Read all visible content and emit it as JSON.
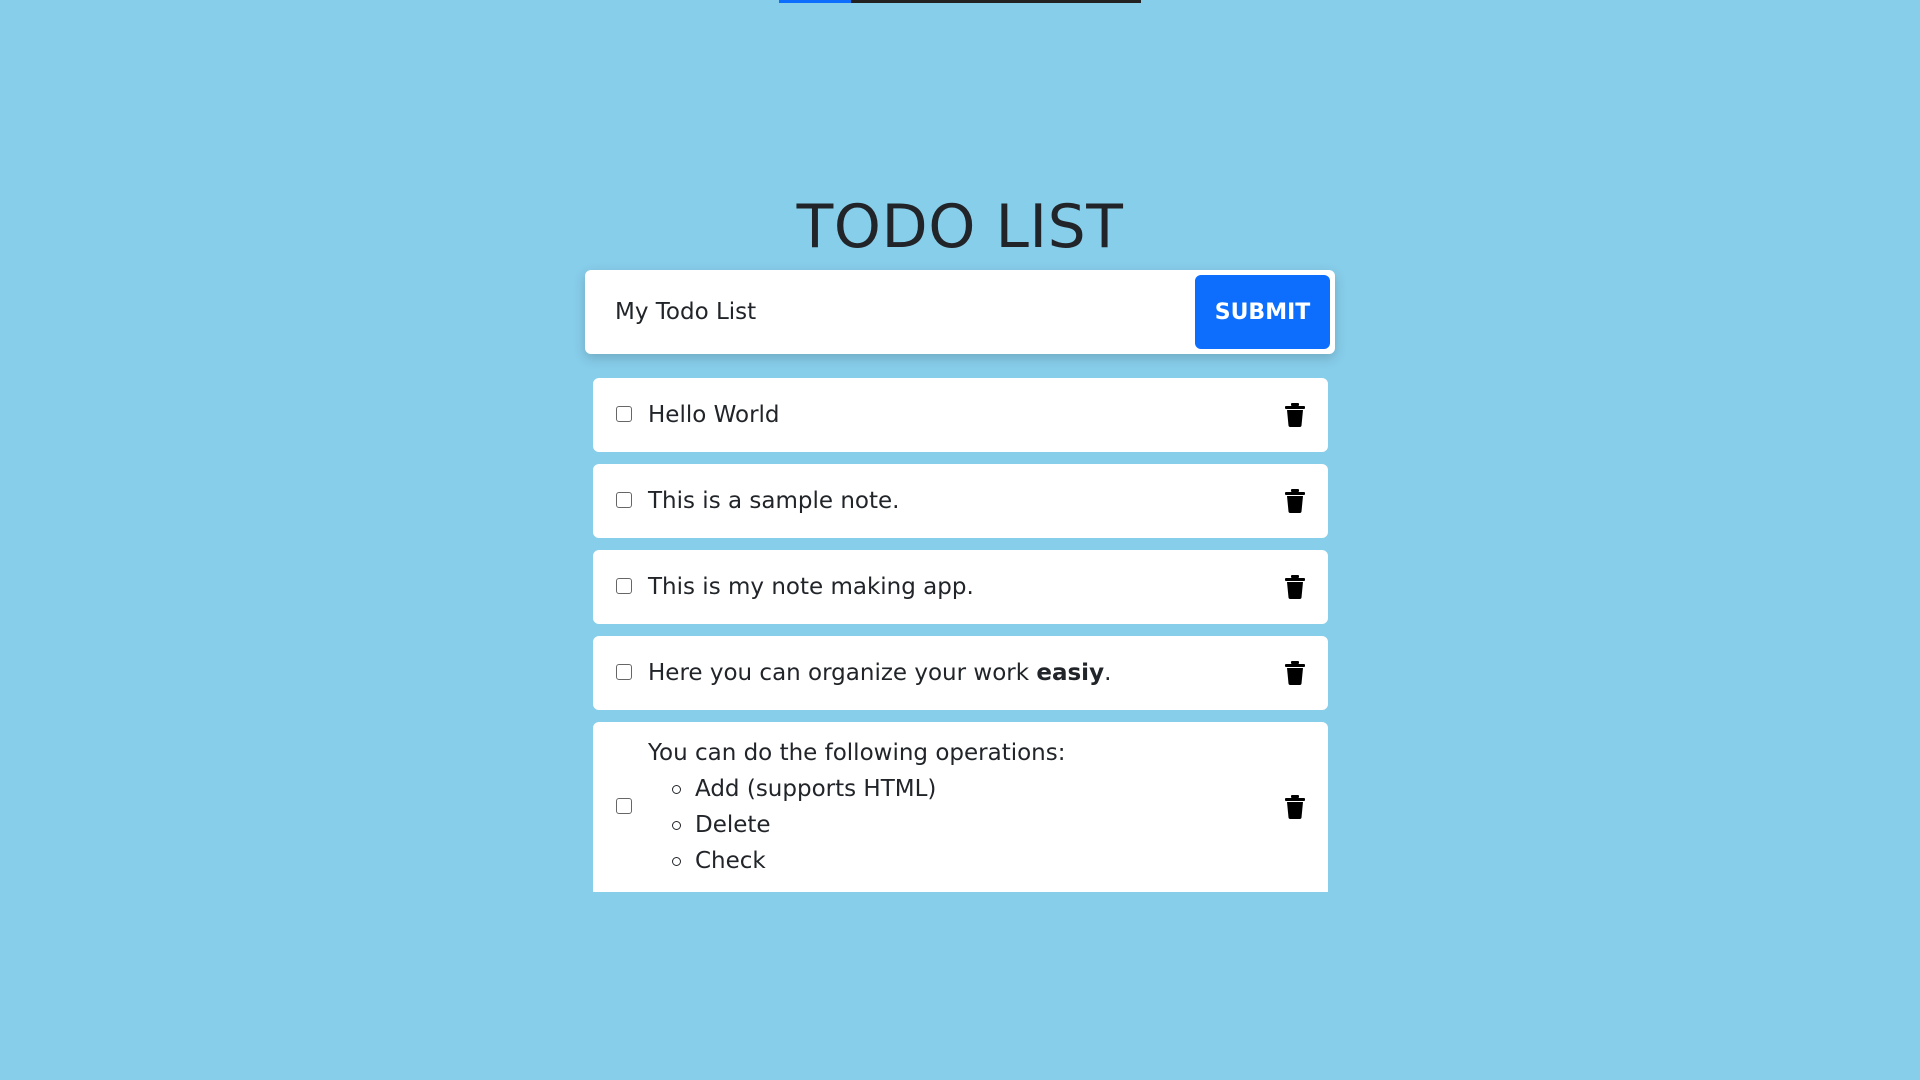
{
  "progress": {
    "fraction": 0.2,
    "fill_color": "#0d6efd",
    "track_color": "#222222"
  },
  "app": {
    "title": "TODO LIST"
  },
  "form": {
    "input_value": "My Todo List",
    "submit_label": "SUBMIT"
  },
  "todos": [
    {
      "text": "Hello World",
      "checked": false
    },
    {
      "text": "This is a sample note.",
      "checked": false
    },
    {
      "text": "This is my note making app.",
      "checked": false
    },
    {
      "text_before": "Here you can organize your work ",
      "text_bold": "easiy",
      "text_after": ".",
      "checked": false
    },
    {
      "intro": "You can do the following operations:",
      "operations": [
        "Add (supports HTML)",
        "Delete",
        "Check"
      ],
      "checked": false
    }
  ],
  "icons": {
    "delete": "trash-icon"
  },
  "colors": {
    "background": "#87ceeb",
    "accent": "#0d6efd",
    "card": "#ffffff",
    "text": "#212529"
  }
}
